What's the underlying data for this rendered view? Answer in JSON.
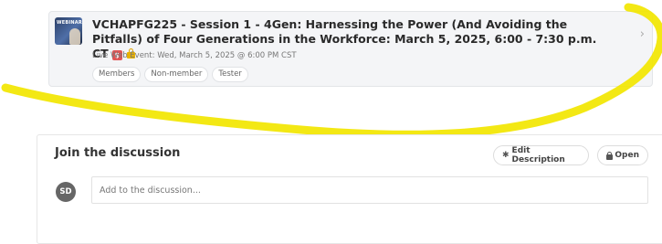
{
  "event": {
    "thumbnail_text": "WEBINAR",
    "title": "VCHAPFG225 - Session 1 - 4Gen: Harnessing the Power (And Avoiding the Pitfalls) of Four Generations in the Workforce: March 5, 2025, 6:00 - 7:30 p.m. CT",
    "paid_badge": "$",
    "meta": "Live Web Event:  Wed, March 5, 2025 @ 6:00 PM CST",
    "tags": [
      "Members",
      "Non-member",
      "Tester"
    ],
    "chevron": "›"
  },
  "discussion": {
    "title": "Join the discussion",
    "edit_description_label": "Edit Description",
    "open_label": "Open",
    "gear_glyph": "✱",
    "avatar_initials": "SD",
    "input_placeholder": "Add to the discussion..."
  },
  "colors": {
    "highlight_stroke": "#f2e600",
    "paid_badge": "#e05555",
    "lock": "#e8b100"
  }
}
